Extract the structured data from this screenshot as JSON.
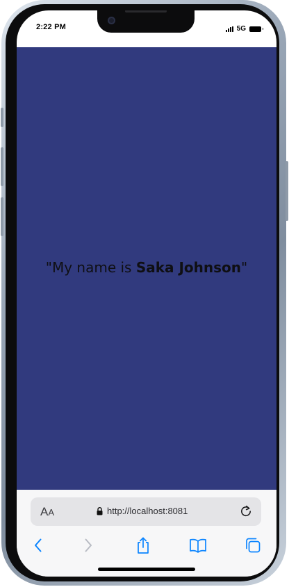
{
  "status_bar": {
    "time": "2:22 PM",
    "network": "5G"
  },
  "page": {
    "background_color": "#313a7e",
    "greeting_prefix": "\"My name is ",
    "greeting_name": "Saka Johnson",
    "greeting_suffix": "\""
  },
  "safari": {
    "text_size_label_large": "A",
    "text_size_label_small": "A",
    "url": "http://localhost:8081",
    "accent_color": "#0a84ff",
    "icons": {
      "text_size": "aa-icon",
      "secure": "lock-icon",
      "reload": "reload-icon",
      "back": "chevron-left-icon",
      "forward": "chevron-right-icon",
      "share": "share-icon",
      "bookmarks": "book-icon",
      "tabs": "tabs-icon"
    }
  }
}
